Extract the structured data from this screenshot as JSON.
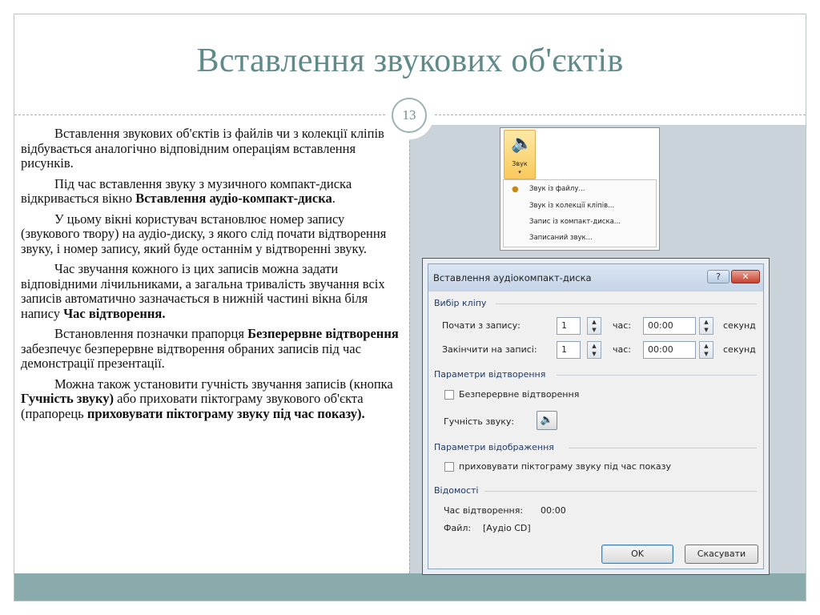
{
  "slide": {
    "title": "Вставлення звукових об'єктів",
    "page_number": "13"
  },
  "paragraphs": [
    [
      {
        "t": "Вставлення звукових об'єктів із файлів чи з колекції кліпів відбувається аналогічно відповідним операціям вставлення рисунків.",
        "b": false
      }
    ],
    [
      {
        "t": "Під час вставлення звуку з музичного компакт-диска відкривається вікно ",
        "b": false
      },
      {
        "t": "Вставлення аудіо-компакт-диска",
        "b": true
      },
      {
        "t": ".",
        "b": false
      }
    ],
    [
      {
        "t": "У цьому вікні користувач встановлює номер запису (звукового твору) на аудіо-диску, з якого слід почати відтворення звуку, і номер запису, який буде останнім у відтворенні звуку.",
        "b": false
      }
    ],
    [
      {
        "t": "Час звучання кожного із цих записів можна задати відповідними лічильниками, а загальна тривалість звучання всіх записів автоматично зазначається в нижній частині вікна біля напису ",
        "b": false
      },
      {
        "t": "Час відтворення.",
        "b": true
      }
    ],
    [
      {
        "t": "Встановлення позначки прапорця ",
        "b": false
      },
      {
        "t": "Безперервне відтворення",
        "b": true
      },
      {
        "t": " забезпечує безперервне відтворення обраних записів під час демонстрації презентації.",
        "b": false
      }
    ],
    [
      {
        "t": "Можна також установити гучність звучання записів (кнопка ",
        "b": false
      },
      {
        "t": "Гучність звуку)",
        "b": true
      },
      {
        "t": " або приховати піктограму звукового об'єкта (прапорець ",
        "b": false
      },
      {
        "t": "приховувати піктограму звуку під час показу).",
        "b": true
      }
    ]
  ],
  "sound_menu": {
    "button_label": "Звук",
    "arrow": "▾",
    "items": [
      "Звук із файлу...",
      "Звук із колекції кліпів...",
      "Запис із компакт-диска...",
      "Записаний звук..."
    ]
  },
  "dialog": {
    "title": "Вставлення аудіокомпакт-диска",
    "help": "?",
    "close": "✕",
    "group_clip": "Вибір кліпу",
    "start_label": "Почати з запису:",
    "start_value": "1",
    "end_label": "Закінчити на записі:",
    "end_value": "1",
    "time_label": "час:",
    "start_time": "00:00",
    "end_time": "00:00",
    "seconds": "секунд",
    "group_playback": "Параметри відтворення",
    "loop_label": "Безперервне відтворення",
    "volume_label": "Гучність звуку:",
    "group_display": "Параметри відображення",
    "hide_icon_label": "приховувати піктограму звуку під час показу",
    "group_info": "Відомості",
    "play_time_label": "Час відтворення:",
    "play_time_value": "00:00",
    "file_label": "Файл:",
    "file_value": "[Аудіо CD]",
    "ok": "OK",
    "cancel": "Скасувати"
  },
  "colors": {
    "title": "#5f8a89",
    "footer": "#8aabac",
    "content_bg": "#c9d3d9"
  }
}
